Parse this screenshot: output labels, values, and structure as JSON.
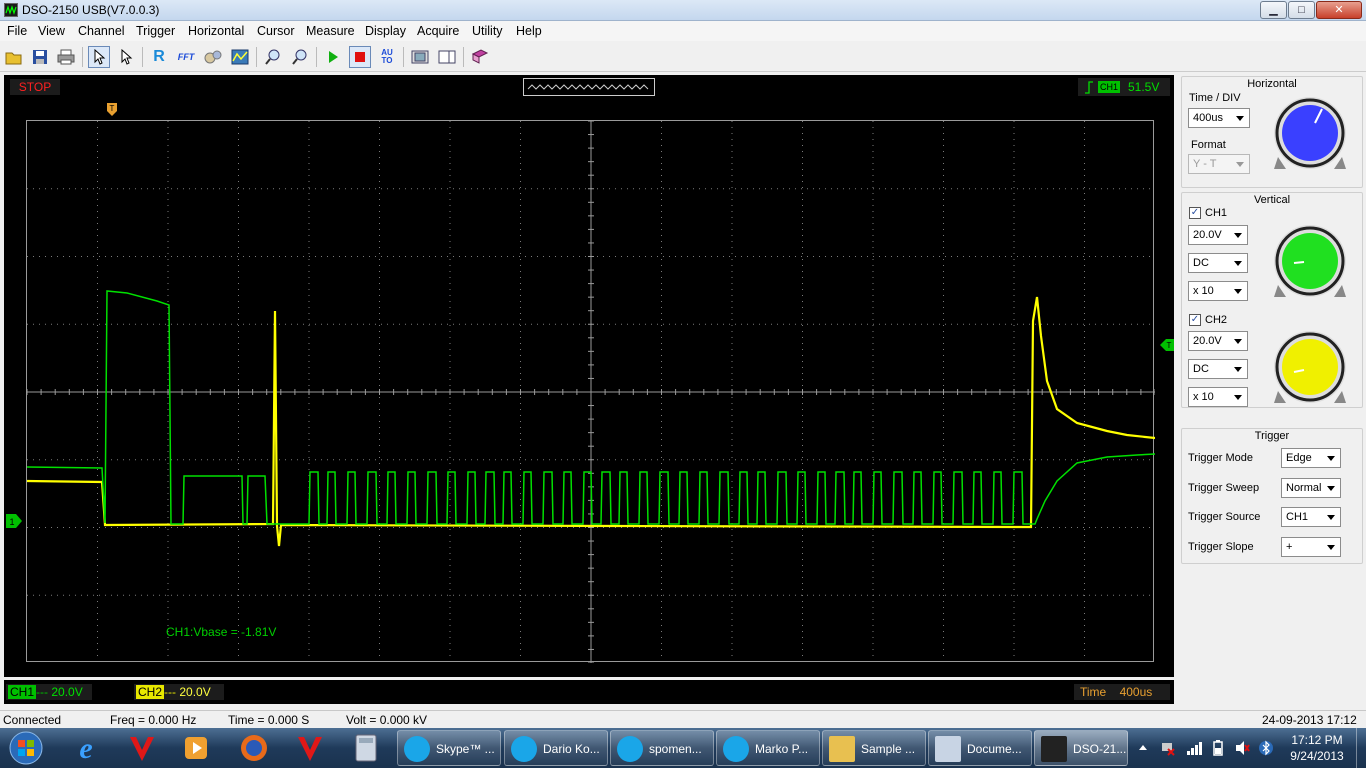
{
  "window": {
    "title": "DSO-2150 USB(V7.0.0.3)",
    "controls": {
      "minimize": "▁",
      "maximize": "□",
      "close": "✕"
    }
  },
  "menu": [
    "File",
    "View",
    "Channel",
    "Trigger",
    "Horizontal",
    "Cursor",
    "Measure",
    "Display",
    "Acquire",
    "Utility",
    "Help"
  ],
  "toolbar": {
    "icons": [
      "open-icon",
      "save-icon",
      "print-icon",
      "select-pointer-icon",
      "pointer-icon",
      "reference-icon",
      "fft-icon",
      "math-icon",
      "spectrum-icon",
      "zoom-in-icon",
      "zoom-out-icon",
      "run-icon",
      "stop-icon",
      "auto-set-icon",
      "snapshot-icon",
      "panel-icon",
      "book-icon"
    ],
    "ref_label": "R",
    "fft_label": "FFT",
    "auto_label": "AU TO"
  },
  "scope": {
    "run_state": "STOP",
    "trigger_status": {
      "channel": "CH1",
      "level": "51.5V"
    },
    "trigger_marker": "T",
    "measurement": "CH1:Vbase = -1.81V",
    "ch1_marker": "1",
    "trigger_level_marker": "T",
    "footer": {
      "ch1_label": "CH1",
      "ch1_scale": "20.0V",
      "ch2_label": "CH2",
      "ch2_scale": "20.0V",
      "time_label": "Time",
      "time_value": "400us"
    },
    "colors": {
      "ch1": "#00e000",
      "ch2": "#ffff00",
      "grid": "#9a9a9a",
      "stop": "#ff2020"
    }
  },
  "panel": {
    "horizontal": {
      "title": "Horizontal",
      "timediv_label": "Time / DIV",
      "timediv_value": "400us",
      "format_label": "Format",
      "format_value": "Y - T",
      "knob_color": "#3a40ff"
    },
    "vertical": {
      "title": "Vertical",
      "ch1": {
        "label": "CH1",
        "checked": "✓",
        "scale": "20.0V",
        "coupling": "DC",
        "probe": "x 10",
        "knob_color": "#20e020"
      },
      "ch2": {
        "label": "CH2",
        "checked": "✓",
        "scale": "20.0V",
        "coupling": "DC",
        "probe": "x 10",
        "knob_color": "#f0f000"
      }
    },
    "trigger": {
      "title": "Trigger",
      "mode_label": "Trigger Mode",
      "mode_value": "Edge",
      "sweep_label": "Trigger Sweep",
      "sweep_value": "Normal",
      "source_label": "Trigger Source",
      "source_value": "CH1",
      "slope_label": "Trigger Slope",
      "slope_value": "+"
    }
  },
  "status": {
    "connection": "Connected",
    "freq": "Freq = 0.000 Hz",
    "time": "Time = 0.000 S",
    "volt": "Volt = 0.000 kV",
    "datetime": "24-09-2013  17:12"
  },
  "taskbar": {
    "items": [
      {
        "name": "taskbar-skype",
        "label": "Skype™ ...",
        "color": "#1aa6e8"
      },
      {
        "name": "taskbar-dario",
        "label": "Dario Ko...",
        "color": "#1aa6e8"
      },
      {
        "name": "taskbar-spomen",
        "label": "spomen...",
        "color": "#1aa6e8"
      },
      {
        "name": "taskbar-marko",
        "label": "Marko P...",
        "color": "#1aa6e8"
      },
      {
        "name": "taskbar-sample",
        "label": "Sample ...",
        "color": "#e8c050"
      },
      {
        "name": "taskbar-document",
        "label": "Docume...",
        "color": "#c8d4e4"
      },
      {
        "name": "taskbar-dso",
        "label": "DSO-21...",
        "color": "#222"
      }
    ],
    "clock_time": "17:12 PM",
    "clock_date": "9/24/2013"
  }
}
